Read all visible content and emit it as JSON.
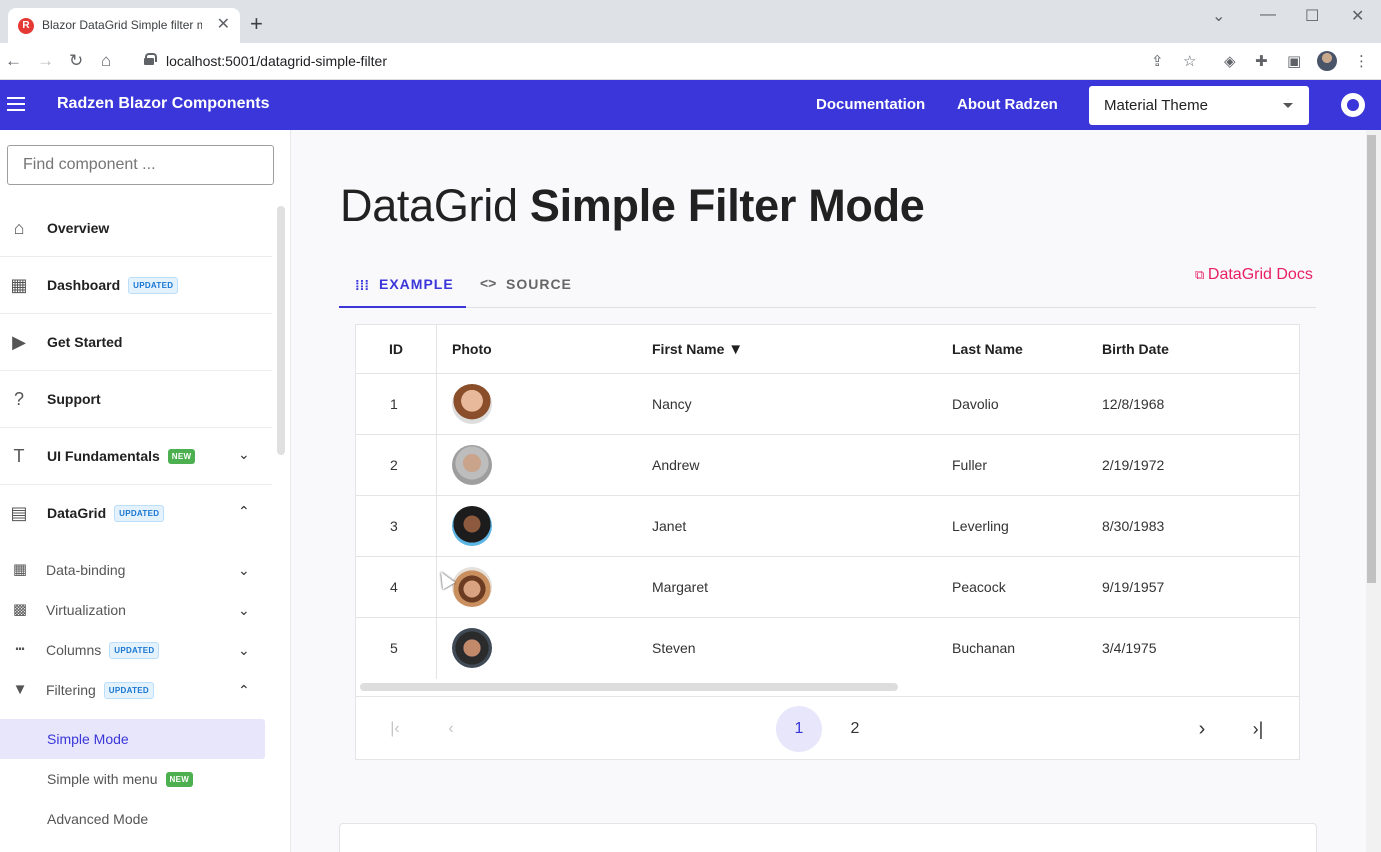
{
  "browser": {
    "tab_title": "Blazor DataGrid Simple filter mo",
    "url": "localhost:5001/datagrid-simple-filter",
    "new_tab": "+",
    "close_tab": "✕"
  },
  "header": {
    "app_title": "Radzen Blazor Components",
    "links": [
      "Documentation",
      "About Radzen"
    ],
    "theme_value": "Material Theme"
  },
  "sidebar": {
    "search_placeholder": "Find component ...",
    "items": [
      {
        "label": "Overview"
      },
      {
        "label": "Dashboard",
        "badge": "UPDATED"
      },
      {
        "label": "Get Started"
      },
      {
        "label": "Support"
      },
      {
        "label": "UI Fundamentals",
        "badge": "NEW"
      },
      {
        "label": "DataGrid",
        "badge": "UPDATED"
      }
    ],
    "sub_items": [
      {
        "label": "Data-binding"
      },
      {
        "label": "Virtualization"
      },
      {
        "label": "Columns",
        "badge": "UPDATED"
      },
      {
        "label": "Filtering",
        "badge": "UPDATED"
      }
    ],
    "leaf_items": [
      {
        "label": "Simple Mode"
      },
      {
        "label": "Simple with menu",
        "badge": "NEW"
      },
      {
        "label": "Advanced Mode"
      }
    ]
  },
  "main": {
    "title_light": "DataGrid",
    "title_bold": "Simple Filter Mode",
    "tabs": [
      {
        "label": "EXAMPLE"
      },
      {
        "label": "SOURCE"
      }
    ],
    "docs_link": "DataGrid Docs"
  },
  "grid": {
    "columns": [
      "ID",
      "Photo",
      "First Name",
      "Last Name",
      "Birth Date"
    ],
    "rows": [
      {
        "id": "1",
        "first": "Nancy",
        "last": "Davolio",
        "birth": "12/8/1968"
      },
      {
        "id": "2",
        "first": "Andrew",
        "last": "Fuller",
        "birth": "2/19/1972"
      },
      {
        "id": "3",
        "first": "Janet",
        "last": "Leverling",
        "birth": "8/30/1983"
      },
      {
        "id": "4",
        "first": "Margaret",
        "last": "Peacock",
        "birth": "9/19/1957"
      },
      {
        "id": "5",
        "first": "Steven",
        "last": "Buchanan",
        "birth": "3/4/1975"
      }
    ],
    "pages": [
      "1",
      "2"
    ],
    "current_page": "1"
  },
  "colors": {
    "primary": "#3a36d9",
    "accent_link": "#e91e63",
    "active_nav_bg": "#e8e6fb"
  }
}
